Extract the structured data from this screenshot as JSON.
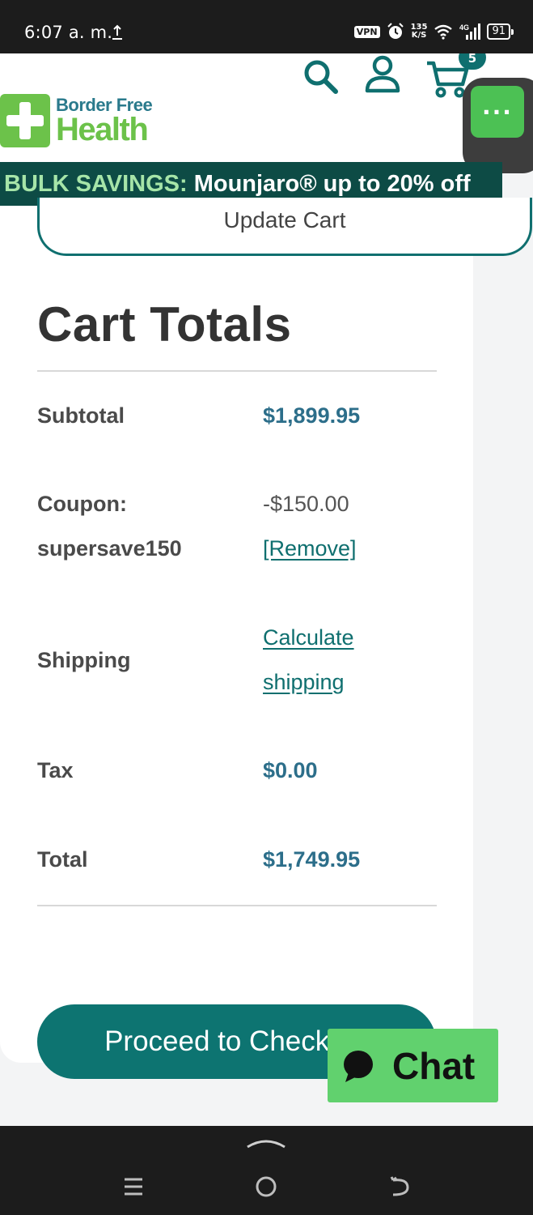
{
  "status_bar": {
    "time": "6:07 a. m.",
    "vpn": "VPN",
    "speed_value": "135",
    "speed_unit": "K/S",
    "network": "4G",
    "battery": "91"
  },
  "header": {
    "logo_top": "Border Free",
    "logo_bottom": "Health",
    "cart_count": "5",
    "more_label": "..."
  },
  "promo": {
    "highlight": "BULK SAVINGS:",
    "text": "Mounjaro® up to 20% off"
  },
  "cart": {
    "update_label": "Update Cart",
    "title": "Cart Totals",
    "subtotal_label": "Subtotal",
    "subtotal_value": "$1,899.95",
    "coupon_label": "Coupon:",
    "coupon_code": "supersave150",
    "coupon_value": "-$150.00",
    "coupon_remove": "[Remove]",
    "shipping_label": "Shipping",
    "shipping_link_line1": "Calculate",
    "shipping_link_line2": "shipping",
    "tax_label": "Tax",
    "tax_value": "$0.00",
    "total_label": "Total",
    "total_value": "$1,749.95",
    "checkout_label": "Proceed to Checkout"
  },
  "chat": {
    "label": "Chat"
  },
  "colors": {
    "brand_teal": "#0f6f6f",
    "brand_green": "#6cc24a",
    "promo_bg": "#0d4b45",
    "price_blue": "#2c6e8a",
    "chat_green": "#61d16e"
  }
}
